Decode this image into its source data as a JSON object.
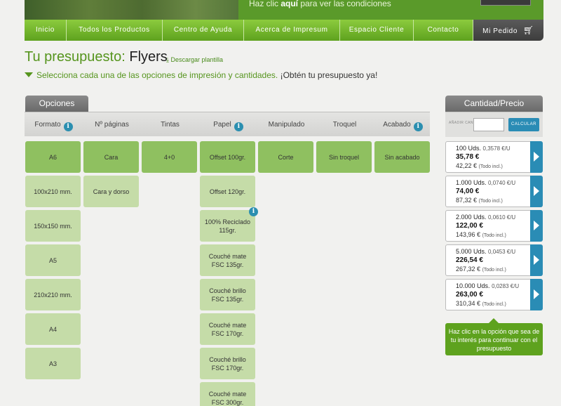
{
  "banner": {
    "text_pre": "Haz clic ",
    "text_bold": "aquí",
    "text_post": " para ver las condiciones"
  },
  "nav": {
    "items": [
      {
        "label": "Inicio"
      },
      {
        "label": "Todos los Productos"
      },
      {
        "label": "Centro de Ayuda"
      },
      {
        "label": "Acerca de Impresum"
      },
      {
        "label": "Espacio Cliente"
      },
      {
        "label": "Contacto"
      }
    ],
    "order_label": "Mi Pedido"
  },
  "page": {
    "title_prefix": "Tu presupuesto: ",
    "title_product": "Flyers",
    "download_label": "Descargar plantilla",
    "subtitle_green": "Selecciona cada una de las opciones de impresión y cantidades.",
    "subtitle_dark": " ¡Obtén tu presupuesto ya!"
  },
  "options": {
    "tab_label": "Opciones",
    "headers": [
      "Formato",
      "Nº páginas",
      "Tintas",
      "Papel",
      "Manipulado",
      "Troquel",
      "Acabado"
    ],
    "columns": {
      "formato": [
        "A6",
        "100x210 mm.",
        "150x150 mm.",
        "A5",
        "210x210 mm.",
        "A4",
        "A3"
      ],
      "paginas": [
        "Cara",
        "Cara y dorso"
      ],
      "tintas": [
        "4+0"
      ],
      "papel": [
        "Offset 100gr.",
        "Offset 120gr.",
        "100% Reciclado 115gr.",
        "Couché mate FSC 135gr.",
        "Couché brillo FSC 135gr.",
        "Couché mate FSC 170gr.",
        "Couché brillo FSC 170gr.",
        "Couché mate FSC 300gr."
      ],
      "manipulado": [
        "Corte"
      ],
      "troquel": [
        "Sin troquel"
      ],
      "acabado": [
        "Sin acabado"
      ]
    }
  },
  "quantity": {
    "tab_label": "Cantidad/Precio",
    "input_label": "AÑADIR CANTIDAD",
    "input_value": "",
    "button_label": "CALCULAR",
    "rows": [
      {
        "units": "100 Uds.",
        "unit_price": "0,3578 €/U",
        "price": "35,78 €",
        "total": "42,22 €",
        "total_note": "(Todo incl.)"
      },
      {
        "units": "1.000 Uds.",
        "unit_price": "0,0740 €/U",
        "price": "74,00 €",
        "total": "87,32 €",
        "total_note": "(Todo incl.)"
      },
      {
        "units": "2.000 Uds.",
        "unit_price": "0,0610 €/U",
        "price": "122,00 €",
        "total": "143,96 €",
        "total_note": "(Todo incl.)"
      },
      {
        "units": "5.000 Uds.",
        "unit_price": "0,0453 €/U",
        "price": "226,54 €",
        "total": "267,32 €",
        "total_note": "(Todo incl.)"
      },
      {
        "units": "10.000 Uds.",
        "unit_price": "0,0283 €/U",
        "price": "263,00 €",
        "total": "310,34 €",
        "total_note": "(Todo incl.)"
      }
    ],
    "hint": "Haz clic en la opción que sea de tu interés para continuar con el presupuesto"
  },
  "colors": {
    "brand_green": "#5ea21e",
    "option_selected": "#8fc060",
    "option_unselected": "#c5dca8",
    "accent_blue": "#2a8cb5"
  }
}
